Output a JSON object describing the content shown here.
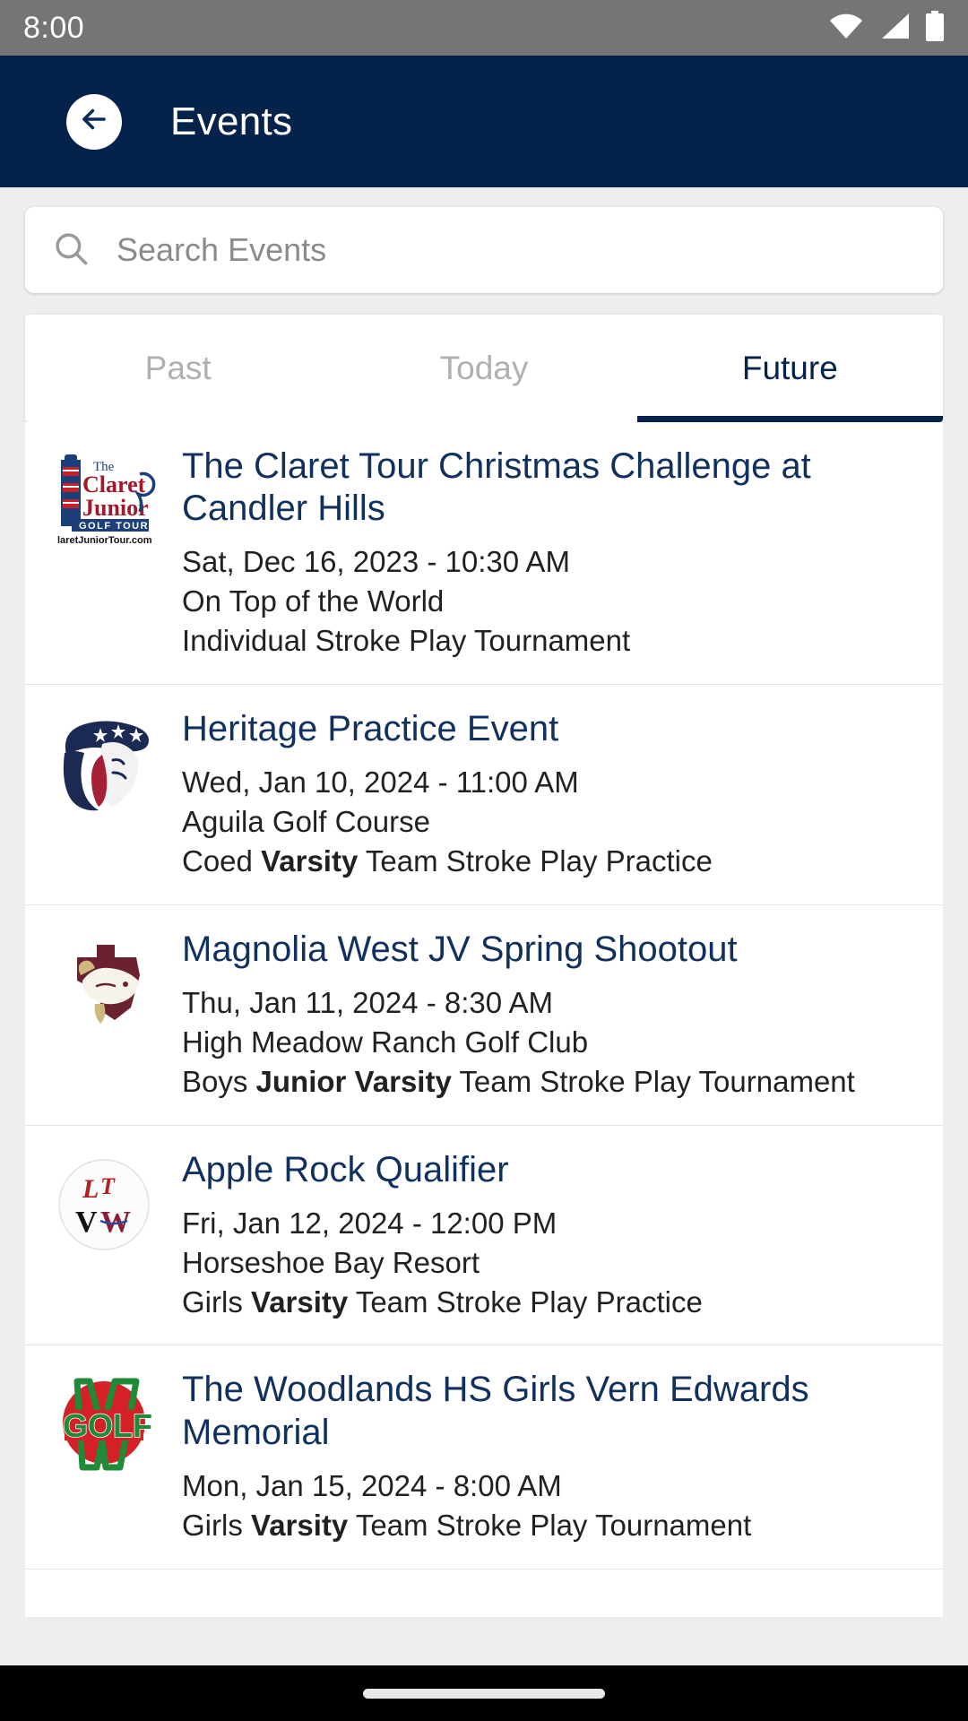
{
  "status_bar": {
    "time": "8:00",
    "icons": [
      "wifi-icon",
      "cell-signal-icon",
      "battery-icon"
    ]
  },
  "app_bar": {
    "back_icon": "arrow-left-icon",
    "title": "Events"
  },
  "search": {
    "icon": "search-icon",
    "placeholder": "Search Events",
    "value": ""
  },
  "tabs": {
    "items": [
      {
        "label": "Past",
        "active": false
      },
      {
        "label": "Today",
        "active": false
      },
      {
        "label": "Future",
        "active": true
      }
    ],
    "active_color": "#04224a",
    "inactive_color": "#b0b0b0"
  },
  "events": [
    {
      "logo": "claret-junior-golf-tour-logo",
      "title": "The Claret Tour Christmas Challenge at Candler Hills",
      "datetime": "Sat, Dec 16, 2023 - 10:30 AM",
      "venue": "On Top of the World",
      "format_prefix": "Individual Stroke Play Tournament",
      "format_bold": "",
      "format_suffix": ""
    },
    {
      "logo": "heritage-patriot-logo",
      "title": "Heritage Practice Event",
      "datetime": "Wed, Jan 10, 2024 - 11:00 AM",
      "venue": "Aguila Golf Course",
      "format_prefix": "Coed ",
      "format_bold": "Varsity",
      "format_suffix": " Team Stroke Play Practice"
    },
    {
      "logo": "magnolia-west-mustang-logo",
      "title": "Magnolia West JV Spring Shootout",
      "datetime": "Thu, Jan 11, 2024 - 8:30 AM",
      "venue": "High Meadow Ranch Golf Club",
      "format_prefix": "Boys ",
      "format_bold": "Junior Varsity",
      "format_suffix": " Team Stroke Play Tournament"
    },
    {
      "logo": "lake-travis-westlake-logo",
      "title": "Apple Rock Qualifier",
      "datetime": "Fri, Jan 12, 2024 - 12:00 PM",
      "venue": "Horseshoe Bay Resort",
      "format_prefix": "Girls ",
      "format_bold": "Varsity",
      "format_suffix": " Team Stroke Play Practice"
    },
    {
      "logo": "woodlands-golf-logo",
      "title": "The Woodlands HS Girls Vern Edwards Memorial",
      "datetime": "Mon, Jan 15, 2024 - 8:00 AM",
      "venue": "",
      "format_prefix": "Girls ",
      "format_bold": "Varsity",
      "format_suffix": " Team Stroke Play Tournament"
    }
  ],
  "nav_bar": {
    "home_indicator": "home-indicator"
  },
  "colors": {
    "header_navy": "#04224a",
    "title_navy": "#12305d",
    "page_bg": "#eeeeee",
    "card_bg": "#ffffff",
    "status_bar_gray": "#757575",
    "body_text": "#212121",
    "muted_text": "#8b8b8b"
  }
}
